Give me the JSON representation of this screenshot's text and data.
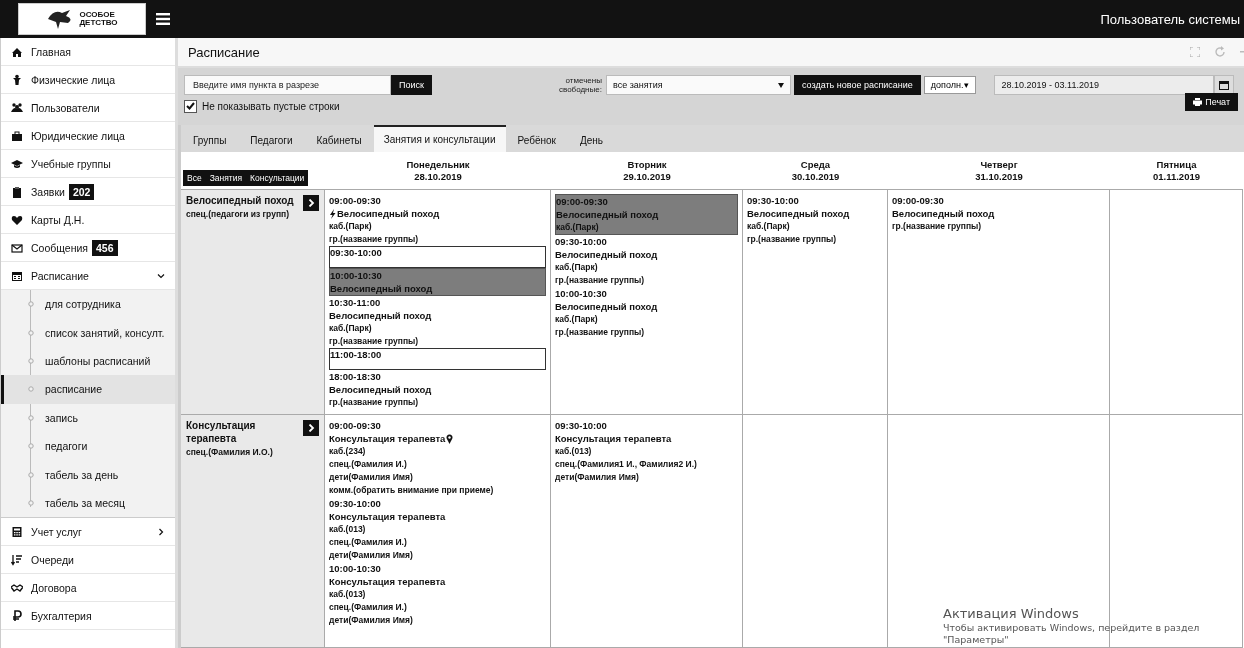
{
  "topbar": {
    "logo_text": [
      "ОСОБОЕ",
      "ДЕТСТВО"
    ],
    "user": "Пользователь системы"
  },
  "sidebar": {
    "items": [
      {
        "label": "Главная"
      },
      {
        "label": "Физические лица"
      },
      {
        "label": "Пользователи"
      },
      {
        "label": "Юридические лица"
      },
      {
        "label": "Учебные группы"
      },
      {
        "label": "Заявки",
        "badge": "202"
      },
      {
        "label": "Карты Д.Н."
      },
      {
        "label": "Сообщения",
        "badge": "456"
      },
      {
        "label": "Расписание",
        "expanded": true,
        "children": [
          {
            "label": "для сотрудника",
            "selected": false
          },
          {
            "label": "список занятий, консулт.",
            "selected": false
          },
          {
            "label": "шаблоны расписаний",
            "selected": false
          },
          {
            "label": "расписание",
            "selected": true
          },
          {
            "label": "запись",
            "selected": false
          },
          {
            "label": "педагоги",
            "selected": false
          },
          {
            "label": "табель за день",
            "selected": false
          },
          {
            "label": "табель за месяц",
            "selected": false
          }
        ]
      },
      {
        "label": "Учет услуг",
        "expanded": false
      },
      {
        "label": "Очереди"
      },
      {
        "label": "Договора"
      },
      {
        "label": "Бухгалтерия"
      }
    ]
  },
  "page": {
    "title": "Расписание",
    "search": {
      "placeholder": "Введите имя пункта в разрезе",
      "button": "Поиск"
    },
    "free_label": "отмечены свободные:",
    "free_select": "все занятия",
    "create_button": "создать новое расписание",
    "more_button": "дополн.▾",
    "date_range": "28.10.2019 - 03.11.2019",
    "print_button": "Печат",
    "hide_empty": {
      "label": "Не показывать пустые строки",
      "checked": true
    },
    "tabs": [
      {
        "label": "Группы",
        "selected": false
      },
      {
        "label": "Педагоги",
        "selected": false
      },
      {
        "label": "Кабинеты",
        "selected": false
      },
      {
        "label": "Занятия и консультации",
        "selected": true
      },
      {
        "label": "Ребёнок",
        "selected": false
      },
      {
        "label": "День",
        "selected": false
      }
    ],
    "filters": [
      "Все",
      "Занятия",
      "Консультации"
    ],
    "days": [
      {
        "name": "Понедельник",
        "date": "28.10.2019"
      },
      {
        "name": "Вторник",
        "date": "29.10.2019"
      },
      {
        "name": "Среда",
        "date": "30.10.2019"
      },
      {
        "name": "Четверг",
        "date": "31.10.2019"
      },
      {
        "name": "Пятница",
        "date": "01.11.2019"
      }
    ],
    "rows": [
      {
        "title": "Велосипедный поход",
        "subtitle": "спец.(педагоги из групп)",
        "cells": [
          [
            {
              "kind": "busy",
              "time": "09:00-09:30",
              "title": "Велосипедный поход",
              "bolt": true,
              "lines": [
                "каб.(Парк)",
                "гр.(название группы)"
              ]
            },
            {
              "kind": "free",
              "time": "09:30-10:00"
            },
            {
              "kind": "marked",
              "time": "10:00-10:30",
              "title": "Велосипедный поход"
            },
            {
              "kind": "busy",
              "time": "10:30-11:00",
              "title": "Велосипедный поход",
              "lines": [
                "каб.(Парк)",
                "гр.(название группы)"
              ]
            },
            {
              "kind": "free",
              "time": "11:00-18:00"
            },
            {
              "kind": "busy",
              "time": "18:00-18:30",
              "title": "Велосипедный поход",
              "lines": [
                "гр.(название группы)"
              ]
            }
          ],
          [
            {
              "kind": "marked",
              "time": "09:00-09:30",
              "title": "Велосипедный поход",
              "lines": [
                "каб.(Парк)"
              ]
            },
            {
              "kind": "busy",
              "time": "09:30-10:00",
              "title": "Велосипедный поход",
              "lines": [
                "каб.(Парк)",
                "гр.(название группы)"
              ]
            },
            {
              "kind": "busy",
              "time": "10:00-10:30",
              "title": "Велосипедный поход",
              "lines": [
                "каб.(Парк)",
                "гр.(название группы)"
              ]
            }
          ],
          [
            {
              "kind": "busy",
              "time": "09:30-10:00",
              "title": "Велосипедный поход",
              "lines": [
                "каб.(Парк)",
                "гр.(название группы)"
              ]
            }
          ],
          [
            {
              "kind": "busy",
              "time": "09:00-09:30",
              "title": "Велосипедный поход",
              "lines": [
                "гр.(название группы)"
              ]
            }
          ],
          []
        ]
      },
      {
        "title": "Консультация терапевта",
        "subtitle": "спец.(Фамилия И.О.)",
        "cells": [
          [
            {
              "kind": "busy",
              "time": "09:00-09:30",
              "title": "Консультация терапевта",
              "pin": true,
              "lines": [
                "каб.(234)",
                "спец.(Фамилия И.)",
                "дети(Фамилия Имя)",
                "комм.(обратить внимание при приеме)"
              ]
            },
            {
              "kind": "busy",
              "time": "09:30-10:00",
              "title": "Консультация терапевта",
              "lines": [
                "каб.(013)",
                "спец.(Фамилия И.)",
                "дети(Фамилия Имя)"
              ]
            },
            {
              "kind": "busy",
              "time": "10:00-10:30",
              "title": "Консультация терапевта",
              "lines": [
                "каб.(013)",
                "спец.(Фамилия И.)",
                "дети(Фамилия Имя)"
              ]
            }
          ],
          [
            {
              "kind": "busy",
              "time": "09:30-10:00",
              "title": "Консультация терапевта",
              "lines": [
                "каб.(013)",
                "спец.(Фамилия1 И., Фамилия2 И.)",
                "дети(Фамилия Имя)"
              ]
            }
          ],
          [],
          [],
          []
        ]
      }
    ]
  },
  "os_overlay": {
    "title": "Активация Windows",
    "text": "Чтобы активировать Windows, перейдите в раздел",
    "text2": "\"Параметры\""
  }
}
